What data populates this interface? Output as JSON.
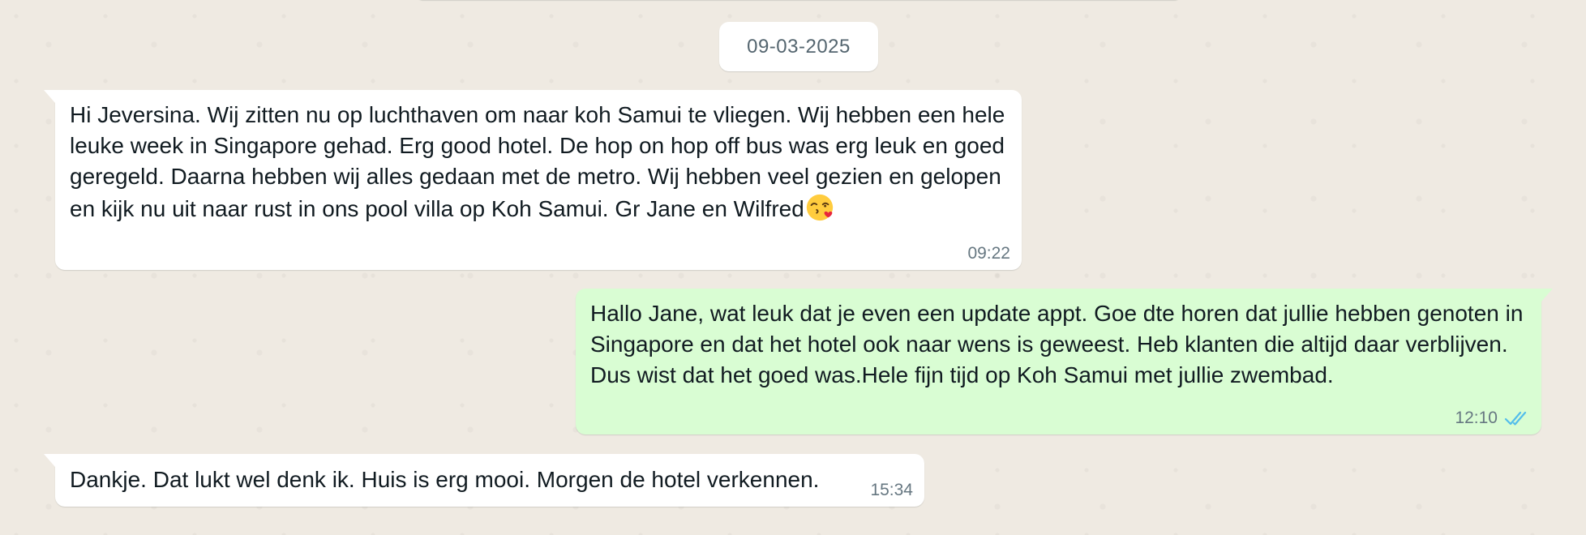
{
  "date_separator": "09-03-2025",
  "messages": [
    {
      "direction": "incoming",
      "text": "Hi Jeversina. Wij zitten nu op luchthaven om naar koh Samui te vliegen. Wij hebben een hele leuke week in Singapore gehad. Erg good hotel. De hop on hop off bus was erg leuk en goed geregeld. Daarna hebben wij alles gedaan met de metro. Wij hebben veel gezien en gelopen en kijk nu uit naar rust in ons pool villa op Koh Samui. Gr Jane en Wilfred",
      "emoji": "😘",
      "time": "09:22"
    },
    {
      "direction": "outgoing",
      "text": "Hallo Jane, wat leuk dat je even een update appt. Goe dte horen dat jullie hebben genoten in Singapore en dat het hotel ook naar wens is geweest. Heb klanten die altijd daar verblijven. Dus wist dat het goed was.Hele fijn tijd op Koh Samui met jullie zwembad.",
      "time": "12:10",
      "status_icon": "double-check-read-icon"
    },
    {
      "direction": "incoming",
      "text": "Dankje. Dat lukt wel denk ik. Huis is erg mooi. Morgen de hotel verkennen.",
      "time": "15:34"
    }
  ],
  "colors": {
    "chat_background": "#efeae2",
    "incoming_bubble": "#ffffff",
    "outgoing_bubble": "#d9fdd3",
    "read_ticks": "#53bdeb",
    "meta_text": "#667781"
  }
}
